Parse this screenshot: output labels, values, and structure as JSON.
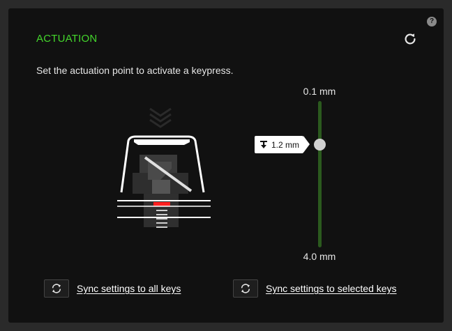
{
  "help": {
    "label": "?"
  },
  "header": {
    "title": "ACTUATION",
    "reset_icon": "reset-icon"
  },
  "description": "Set the actuation point to activate a keypress.",
  "slider": {
    "min_label": "0.1 mm",
    "max_label": "4.0 mm",
    "value_label": "1.2 mm",
    "value_mm": 1.2,
    "min_mm": 0.1,
    "max_mm": 4.0,
    "track_color": "#2b5a1e",
    "thumb_color": "#d0d0d0"
  },
  "sync": {
    "all_keys_label": "Sync settings to all keys",
    "selected_keys_label": "Sync settings to selected keys"
  },
  "colors": {
    "accent": "#44d62c",
    "background": "#111111",
    "marker": "#ff2020"
  }
}
